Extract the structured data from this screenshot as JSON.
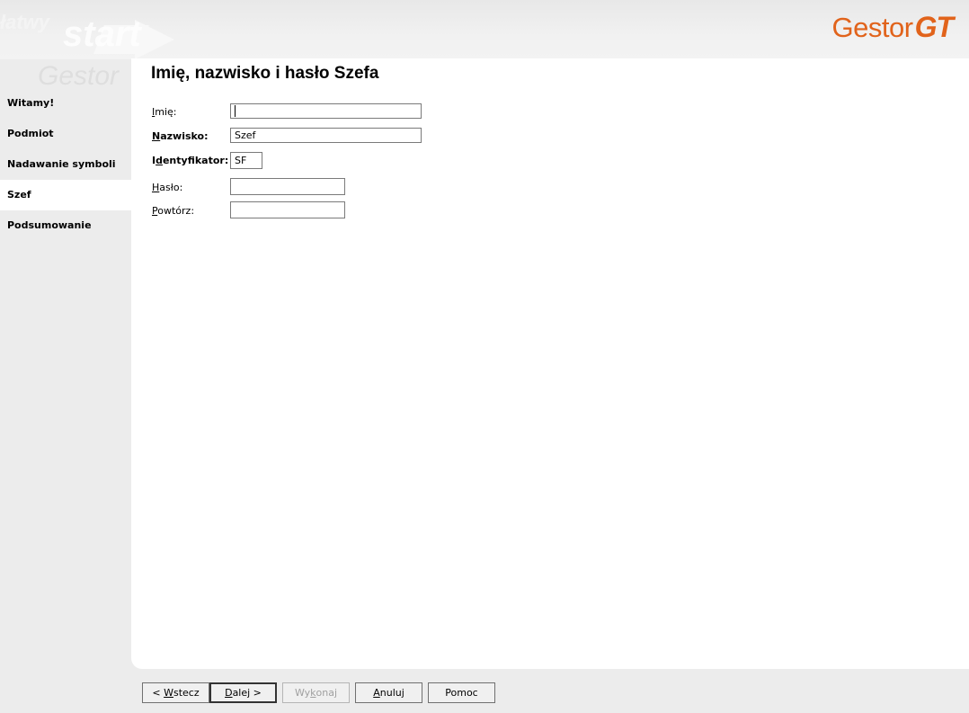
{
  "header": {
    "logo_main": "Gestor",
    "logo_accent": "GT",
    "watermark": [
      "łatwy",
      "start",
      "Gestor"
    ]
  },
  "sidebar": {
    "items": [
      {
        "label": "Witamy!",
        "active": false
      },
      {
        "label": "Podmiot",
        "active": false
      },
      {
        "label": "Nadawanie symboli",
        "active": false
      },
      {
        "label": "Szef",
        "active": true
      },
      {
        "label": "Podsumowanie",
        "active": false
      }
    ]
  },
  "main": {
    "title": "Imię, nazwisko i hasło Szefa",
    "fields": {
      "first_name": {
        "label_pre": "I",
        "label_rest": "mię:",
        "value": ""
      },
      "last_name": {
        "label_pre": "N",
        "label_rest": "azwisko:",
        "value": "Szef"
      },
      "identifier": {
        "label_pre1": "I",
        "label_u": "d",
        "label_rest": "entyfikator:",
        "value": "SF"
      },
      "password": {
        "label_pre": "H",
        "label_rest": "asło:",
        "value": ""
      },
      "repeat": {
        "label_pre": "P",
        "label_rest": "owtórz:",
        "value": ""
      }
    }
  },
  "buttons": {
    "back": {
      "pre": "< ",
      "u": "W",
      "rest": "stecz"
    },
    "next": {
      "u": "D",
      "rest": "alej >"
    },
    "execute": {
      "pre": "Wy",
      "u": "k",
      "rest": "onaj"
    },
    "cancel": {
      "u": "A",
      "rest": "nuluj"
    },
    "help": {
      "label": "Pomoc"
    }
  },
  "colors": {
    "brand": "#e1631b",
    "background": "#ececec",
    "panel": "#ffffff"
  }
}
